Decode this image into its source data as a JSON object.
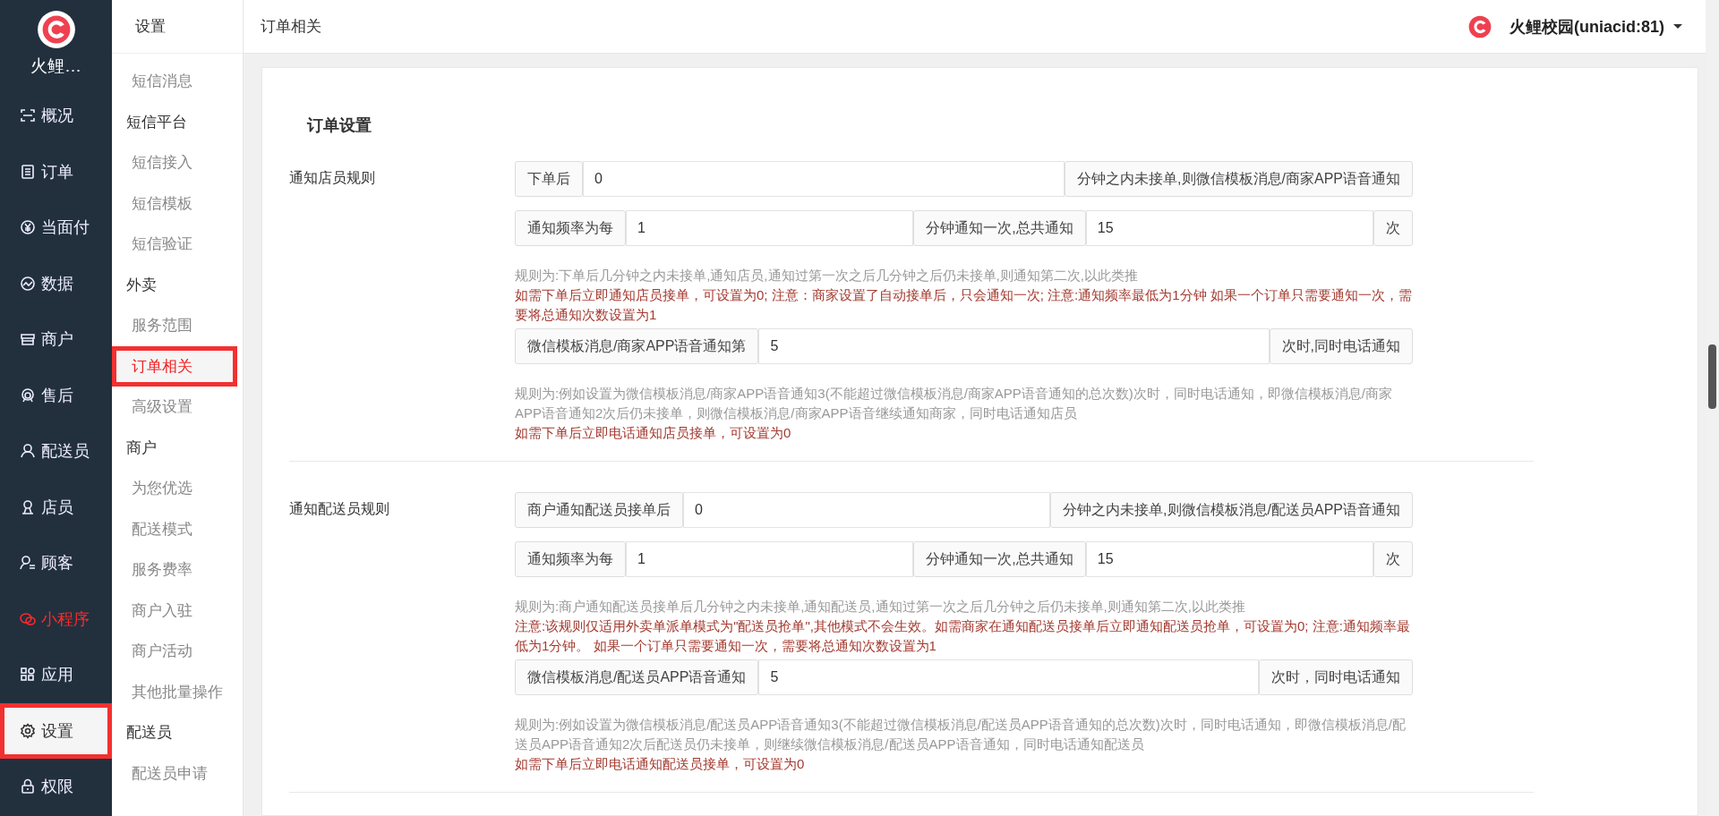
{
  "sidebar": {
    "logo_text": "火鲤…",
    "items": [
      {
        "label": "概况",
        "selected": false,
        "accent": false,
        "annotated": false
      },
      {
        "label": "订单",
        "selected": false,
        "accent": false,
        "annotated": false
      },
      {
        "label": "当面付",
        "selected": false,
        "accent": false,
        "annotated": false
      },
      {
        "label": "数据",
        "selected": false,
        "accent": false,
        "annotated": false
      },
      {
        "label": "商户",
        "selected": false,
        "accent": false,
        "annotated": false
      },
      {
        "label": "售后",
        "selected": false,
        "accent": false,
        "annotated": false
      },
      {
        "label": "配送员",
        "selected": false,
        "accent": false,
        "annotated": false
      },
      {
        "label": "店员",
        "selected": false,
        "accent": false,
        "annotated": false
      },
      {
        "label": "顾客",
        "selected": false,
        "accent": false,
        "annotated": false
      },
      {
        "label": "小程序",
        "selected": false,
        "accent": true,
        "annotated": false
      },
      {
        "label": "应用",
        "selected": false,
        "accent": false,
        "annotated": false
      },
      {
        "label": "设置",
        "selected": true,
        "accent": false,
        "annotated": true
      },
      {
        "label": "权限",
        "selected": false,
        "accent": false,
        "annotated": false
      }
    ]
  },
  "subnav": {
    "title": "设置",
    "items": [
      {
        "kind": "link",
        "label": "短信消息",
        "selected": false,
        "annotated": false
      },
      {
        "kind": "group",
        "label": "短信平台"
      },
      {
        "kind": "link",
        "label": "短信接入",
        "selected": false,
        "annotated": false
      },
      {
        "kind": "link",
        "label": "短信模板",
        "selected": false,
        "annotated": false
      },
      {
        "kind": "link",
        "label": "短信验证",
        "selected": false,
        "annotated": false
      },
      {
        "kind": "group",
        "label": "外卖"
      },
      {
        "kind": "link",
        "label": "服务范围",
        "selected": false,
        "annotated": false
      },
      {
        "kind": "link",
        "label": "订单相关",
        "selected": true,
        "annotated": true
      },
      {
        "kind": "link",
        "label": "高级设置",
        "selected": false,
        "annotated": false
      },
      {
        "kind": "group",
        "label": "商户"
      },
      {
        "kind": "link",
        "label": "为您优选",
        "selected": false,
        "annotated": false
      },
      {
        "kind": "link",
        "label": "配送模式",
        "selected": false,
        "annotated": false
      },
      {
        "kind": "link",
        "label": "服务费率",
        "selected": false,
        "annotated": false
      },
      {
        "kind": "link",
        "label": "商户入驻",
        "selected": false,
        "annotated": false
      },
      {
        "kind": "link",
        "label": "商户活动",
        "selected": false,
        "annotated": false
      },
      {
        "kind": "link",
        "label": "其他批量操作",
        "selected": false,
        "annotated": false
      },
      {
        "kind": "group",
        "label": "配送员"
      },
      {
        "kind": "link",
        "label": "配送员申请",
        "selected": false,
        "annotated": false
      }
    ]
  },
  "topbar": {
    "page_title": "订单相关",
    "account": "火鲤校园(uniacid:81)"
  },
  "card": {
    "title": "订单设置",
    "sections": [
      {
        "label": "通知店员规则",
        "blocks": [
          {
            "kind": "inputs",
            "parts": [
              {
                "kind": "addon",
                "text": "下单后"
              },
              {
                "kind": "input",
                "value": "0"
              },
              {
                "kind": "addon",
                "text": "分钟之内未接单,则微信模板消息/商家APP语音通知"
              }
            ]
          },
          {
            "kind": "inputs",
            "parts": [
              {
                "kind": "addon",
                "text": "通知频率为每"
              },
              {
                "kind": "input",
                "value": "1"
              },
              {
                "kind": "addon",
                "text": "分钟通知一次,总共通知"
              },
              {
                "kind": "input",
                "value": "15"
              },
              {
                "kind": "addon",
                "text": "次"
              }
            ]
          },
          {
            "kind": "help",
            "text": "规则为:下单后几分钟之内未接单,通知店员,通知过第一次之后几分钟之后仍未接单,则通知第二次,以此类推"
          },
          {
            "kind": "warning",
            "text": "如需下单后立即通知店员接单，可设置为0; 注意：商家设置了自动接单后，只会通知一次; 注意:通知频率最低为1分钟 如果一个订单只需要通知一次，需要将总通知次数设置为1"
          },
          {
            "kind": "inputs",
            "parts": [
              {
                "kind": "addon",
                "text": "微信模板消息/商家APP语音通知第"
              },
              {
                "kind": "input",
                "value": "5"
              },
              {
                "kind": "addon",
                "text": "次时,同时电话通知"
              }
            ]
          },
          {
            "kind": "help",
            "text": "规则为:例如设置为微信模板消息/商家APP语音通知3(不能超过微信模板消息/商家APP语音通知的总次数)次时，同时电话通知，即微信模板消息/商家APP语音通知2次后仍未接单，则微信模板消息/商家APP语音继续通知商家，同时电话通知店员"
          },
          {
            "kind": "warning",
            "text": "如需下单后立即电话通知店员接单，可设置为0"
          }
        ]
      },
      {
        "label": "通知配送员规则",
        "blocks": [
          {
            "kind": "inputs",
            "parts": [
              {
                "kind": "addon",
                "text": "商户通知配送员接单后"
              },
              {
                "kind": "input",
                "value": "0"
              },
              {
                "kind": "addon",
                "text": "分钟之内未接单,则微信模板消息/配送员APP语音通知"
              }
            ]
          },
          {
            "kind": "inputs",
            "parts": [
              {
                "kind": "addon",
                "text": "通知频率为每"
              },
              {
                "kind": "input",
                "value": "1"
              },
              {
                "kind": "addon",
                "text": "分钟通知一次,总共通知"
              },
              {
                "kind": "input",
                "value": "15"
              },
              {
                "kind": "addon",
                "text": "次"
              }
            ]
          },
          {
            "kind": "help",
            "text": "规则为:商户通知配送员接单后几分钟之内未接单,通知配送员,通知过第一次之后几分钟之后仍未接单,则通知第二次,以此类推"
          },
          {
            "kind": "warning",
            "text": "注意:该规则仅适用外卖单派单模式为\"配送员抢单\",其他模式不会生效。如需商家在通知配送员接单后立即通知配送员抢单，可设置为0; 注意:通知频率最低为1分钟。 如果一个订单只需要通知一次，需要将总通知次数设置为1"
          },
          {
            "kind": "inputs",
            "parts": [
              {
                "kind": "addon",
                "text": "微信模板消息/配送员APP语音通知"
              },
              {
                "kind": "input",
                "value": "5"
              },
              {
                "kind": "addon",
                "text": "次时，同时电话通知"
              }
            ]
          },
          {
            "kind": "help",
            "text": "规则为:例如设置为微信模板消息/配送员APP语音通知3(不能超过微信模板消息/配送员APP语音通知的总次数)次时，同时电话通知，即微信模板消息/配送员APP语音通知2次后配送员仍未接单，则继续微信模板消息/配送员APP语音通知，同时电话通知配送员"
          },
          {
            "kind": "warning",
            "text": "如需下单后立即电话通知配送员接单，可设置为0"
          }
        ]
      }
    ]
  }
}
